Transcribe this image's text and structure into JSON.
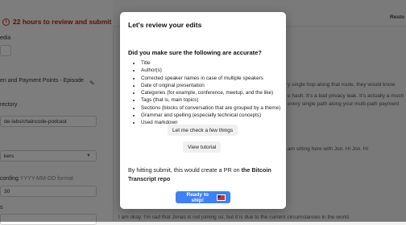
{
  "sidebar": {
    "deadline": "22 hours to review and submit",
    "media_label": "edia",
    "title_value": "en and Payment Points - Episode",
    "directory_label": "rectory",
    "directory_value": "de-labs/chaincode-podcast",
    "speakers_value": "kers",
    "recording_label": "cording",
    "recording_hint": "YYYY-MM-DD format",
    "recording_value": "30",
    "bottom_label": "s"
  },
  "topbar": {
    "restore_label": "Resto"
  },
  "content": {
    "line1": "y single hop along that route, they would know",
    "line2": "e hash. It's a bad privacy leak. It's actually a much",
    "line3": "every single path along your multi-path payment",
    "line4": "am sitting here with Jon. Hi Jon. Hi",
    "line5": "I am okay. I'm sad that Jonas is not joining us, but it is due to the current circumstances in the world."
  },
  "modal": {
    "title": "Let's review your edits",
    "question": "Did you make sure the following are accurate?",
    "checklist": [
      "Title",
      "Author(s)",
      "Corrected speaker names in case of multiple speakers",
      "Date of original presentation",
      "Categories (for example, conference, meetup, and the like)",
      "Tags (that is, main topics)",
      "Sections (blocks of conversation that are grouped by a theme)",
      "Grammar and spelling (especially technical concepts)",
      "Used markdown"
    ],
    "check_button": "Let me check a few things",
    "tutorial_button": "View tutorial",
    "submit_note_prefix": "By hitting submit, this would create a PR on ",
    "submit_note_repo": "the Bitcoin Transcript repo",
    "ready_button": "Ready to ship!"
  },
  "colors": {
    "deadline": "#b42318",
    "primary_button": "#3b82f6",
    "overlay": "rgba(0,0,0,0.5)"
  }
}
